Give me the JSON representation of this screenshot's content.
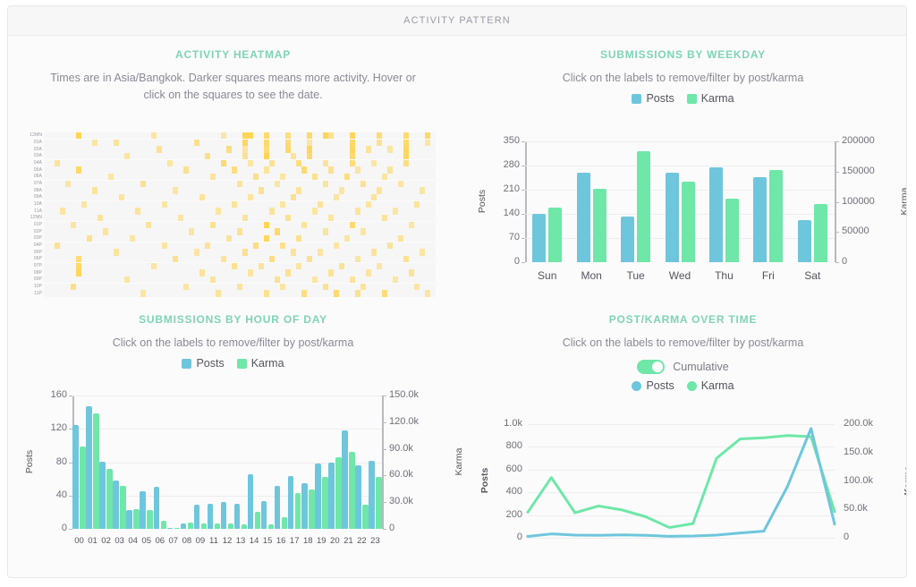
{
  "header": {
    "title": "Activity Pattern"
  },
  "colors": {
    "posts": "#6ec6dd",
    "karma": "#6ee7a8",
    "heatmap": "#ffd34e",
    "title": "#7fd4b8",
    "header_text": "#9a9aa5"
  },
  "heatmap": {
    "title": "Activity Heatmap",
    "description": "Times are in Asia/Bangkok. Darker squares means more activity. Hover or click on the squares to see the date.",
    "row_labels": [
      "12MN",
      "01A",
      "02A",
      "03A",
      "04A",
      "05A",
      "06A",
      "07A",
      "08A",
      "09A",
      "10A",
      "11A",
      "12NN",
      "01P",
      "02P",
      "03P",
      "04P",
      "05P",
      "06P",
      "07P",
      "08P",
      "09P",
      "10P",
      "11P"
    ],
    "columns": 73,
    "cells": [
      [
        0,
        6,
        0.95
      ],
      [
        0,
        20,
        0.5
      ],
      [
        0,
        33,
        0.45
      ],
      [
        0,
        37,
        0.95
      ],
      [
        0,
        38,
        0.95
      ],
      [
        0,
        41,
        0.8
      ],
      [
        0,
        45,
        0.7
      ],
      [
        0,
        49,
        0.85
      ],
      [
        0,
        52,
        0.95
      ],
      [
        0,
        53,
        0.6
      ],
      [
        0,
        57,
        0.9
      ],
      [
        0,
        62,
        0.75
      ],
      [
        0,
        67,
        0.8
      ],
      [
        0,
        71,
        0.85
      ],
      [
        1,
        9,
        0.5
      ],
      [
        1,
        13,
        0.55
      ],
      [
        1,
        28,
        0.65
      ],
      [
        1,
        37,
        0.9
      ],
      [
        1,
        41,
        0.8
      ],
      [
        1,
        45,
        0.75
      ],
      [
        1,
        49,
        0.5
      ],
      [
        1,
        57,
        0.85
      ],
      [
        1,
        62,
        0.6
      ],
      [
        1,
        67,
        0.85
      ],
      [
        1,
        71,
        0.5
      ],
      [
        2,
        21,
        0.6
      ],
      [
        2,
        34,
        0.7
      ],
      [
        2,
        37,
        0.5
      ],
      [
        2,
        41,
        0.75
      ],
      [
        2,
        45,
        0.85
      ],
      [
        2,
        49,
        0.9
      ],
      [
        2,
        57,
        0.9
      ],
      [
        2,
        60,
        0.55
      ],
      [
        2,
        64,
        0.5
      ],
      [
        2,
        67,
        0.9
      ],
      [
        3,
        15,
        0.5
      ],
      [
        3,
        30,
        0.65
      ],
      [
        3,
        37,
        0.6
      ],
      [
        3,
        41,
        0.95
      ],
      [
        3,
        46,
        0.55
      ],
      [
        3,
        49,
        0.8
      ],
      [
        3,
        57,
        0.8
      ],
      [
        3,
        67,
        0.9
      ],
      [
        4,
        2,
        0.55
      ],
      [
        4,
        23,
        0.5
      ],
      [
        4,
        33,
        0.8
      ],
      [
        4,
        38,
        0.5
      ],
      [
        4,
        42,
        0.6
      ],
      [
        4,
        47,
        0.7
      ],
      [
        4,
        52,
        0.55
      ],
      [
        4,
        57,
        0.75
      ],
      [
        4,
        61,
        0.5
      ],
      [
        4,
        67,
        0.7
      ],
      [
        5,
        6,
        0.85
      ],
      [
        5,
        26,
        0.6
      ],
      [
        5,
        35,
        0.7
      ],
      [
        5,
        41,
        0.55
      ],
      [
        5,
        48,
        0.8
      ],
      [
        5,
        53,
        0.6
      ],
      [
        5,
        58,
        0.5
      ],
      [
        5,
        64,
        0.55
      ],
      [
        6,
        12,
        0.5
      ],
      [
        6,
        31,
        0.55
      ],
      [
        6,
        39,
        0.65
      ],
      [
        6,
        44,
        0.5
      ],
      [
        6,
        50,
        0.6
      ],
      [
        6,
        56,
        0.7
      ],
      [
        6,
        63,
        0.5
      ],
      [
        7,
        4,
        0.5
      ],
      [
        7,
        18,
        0.6
      ],
      [
        7,
        36,
        0.55
      ],
      [
        7,
        43,
        0.5
      ],
      [
        7,
        52,
        0.55
      ],
      [
        7,
        59,
        0.6
      ],
      [
        7,
        66,
        0.5
      ],
      [
        8,
        9,
        0.55
      ],
      [
        8,
        24,
        0.5
      ],
      [
        8,
        40,
        0.6
      ],
      [
        8,
        47,
        0.55
      ],
      [
        8,
        55,
        0.5
      ],
      [
        8,
        62,
        0.55
      ],
      [
        8,
        70,
        0.5
      ],
      [
        9,
        14,
        0.5
      ],
      [
        9,
        29,
        0.55
      ],
      [
        9,
        38,
        0.5
      ],
      [
        9,
        46,
        0.6
      ],
      [
        9,
        54,
        0.5
      ],
      [
        9,
        61,
        0.55
      ],
      [
        10,
        7,
        0.5
      ],
      [
        10,
        22,
        0.5
      ],
      [
        10,
        35,
        0.55
      ],
      [
        10,
        44,
        0.5
      ],
      [
        10,
        51,
        0.55
      ],
      [
        10,
        60,
        0.5
      ],
      [
        10,
        69,
        0.55
      ],
      [
        11,
        3,
        0.5
      ],
      [
        11,
        17,
        0.55
      ],
      [
        11,
        32,
        0.5
      ],
      [
        11,
        42,
        0.55
      ],
      [
        11,
        50,
        0.5
      ],
      [
        11,
        58,
        0.55
      ],
      [
        11,
        65,
        0.5
      ],
      [
        12,
        10,
        0.55
      ],
      [
        12,
        25,
        0.5
      ],
      [
        12,
        37,
        0.55
      ],
      [
        12,
        45,
        0.6
      ],
      [
        12,
        53,
        0.5
      ],
      [
        12,
        63,
        0.55
      ],
      [
        13,
        5,
        0.5
      ],
      [
        13,
        19,
        0.55
      ],
      [
        13,
        31,
        0.6
      ],
      [
        13,
        41,
        0.95
      ],
      [
        13,
        48,
        0.55
      ],
      [
        13,
        57,
        0.8
      ],
      [
        13,
        68,
        0.5
      ],
      [
        14,
        11,
        0.55
      ],
      [
        14,
        27,
        0.5
      ],
      [
        14,
        36,
        0.6
      ],
      [
        14,
        43,
        0.85
      ],
      [
        14,
        52,
        0.55
      ],
      [
        14,
        59,
        0.5
      ],
      [
        15,
        8,
        0.6
      ],
      [
        15,
        16,
        0.5
      ],
      [
        15,
        34,
        0.55
      ],
      [
        15,
        41,
        0.9
      ],
      [
        15,
        47,
        0.6
      ],
      [
        15,
        56,
        0.5
      ],
      [
        15,
        66,
        0.55
      ],
      [
        16,
        2,
        0.6
      ],
      [
        16,
        22,
        0.5
      ],
      [
        16,
        30,
        0.55
      ],
      [
        16,
        39,
        0.7
      ],
      [
        16,
        44,
        0.6
      ],
      [
        16,
        54,
        0.5
      ],
      [
        16,
        64,
        0.55
      ],
      [
        17,
        13,
        0.55
      ],
      [
        17,
        28,
        0.5
      ],
      [
        17,
        37,
        0.6
      ],
      [
        17,
        46,
        0.55
      ],
      [
        17,
        51,
        0.5
      ],
      [
        17,
        61,
        0.55
      ],
      [
        17,
        70,
        0.5
      ],
      [
        18,
        6,
        0.75
      ],
      [
        18,
        24,
        0.6
      ],
      [
        18,
        33,
        0.55
      ],
      [
        18,
        42,
        0.7
      ],
      [
        18,
        49,
        0.6
      ],
      [
        18,
        58,
        0.5
      ],
      [
        18,
        67,
        0.6
      ],
      [
        19,
        6,
        0.85
      ],
      [
        19,
        20,
        0.5
      ],
      [
        19,
        35,
        0.6
      ],
      [
        19,
        40,
        0.55
      ],
      [
        19,
        47,
        0.5
      ],
      [
        19,
        55,
        0.6
      ],
      [
        19,
        62,
        0.5
      ],
      [
        20,
        6,
        0.9
      ],
      [
        20,
        29,
        0.55
      ],
      [
        20,
        38,
        0.5
      ],
      [
        20,
        45,
        0.6
      ],
      [
        20,
        53,
        0.55
      ],
      [
        20,
        60,
        0.5
      ],
      [
        20,
        68,
        0.55
      ],
      [
        21,
        15,
        0.5
      ],
      [
        21,
        31,
        0.55
      ],
      [
        21,
        43,
        0.6
      ],
      [
        21,
        50,
        0.5
      ],
      [
        21,
        57,
        0.55
      ],
      [
        21,
        65,
        0.5
      ],
      [
        22,
        5,
        0.65
      ],
      [
        22,
        26,
        0.5
      ],
      [
        22,
        36,
        0.55
      ],
      [
        22,
        44,
        0.5
      ],
      [
        22,
        52,
        0.6
      ],
      [
        22,
        59,
        0.55
      ],
      [
        22,
        69,
        0.5
      ],
      [
        23,
        18,
        0.5
      ],
      [
        23,
        32,
        0.55
      ],
      [
        23,
        41,
        0.6
      ],
      [
        23,
        48,
        0.7
      ],
      [
        23,
        54,
        0.8
      ],
      [
        23,
        58,
        0.6
      ],
      [
        23,
        63,
        0.75
      ],
      [
        23,
        71,
        0.5
      ]
    ]
  },
  "weekday": {
    "title": "Submissions by Weekday",
    "description": "Click on the labels to remove/filter by post/karma",
    "legend": [
      {
        "label": "Posts",
        "color": "#6ec6dd"
      },
      {
        "label": "Karma",
        "color": "#6ee7a8"
      }
    ]
  },
  "hourly": {
    "title": "Submissions by Hour of Day",
    "description": "Click on the labels to remove/filter by post/karma",
    "legend": [
      {
        "label": "Posts",
        "color": "#6ec6dd"
      },
      {
        "label": "Karma",
        "color": "#6ee7a8"
      }
    ]
  },
  "overtime": {
    "title": "Post/Karma Over Time",
    "description": "Click on the labels to remove/filter by post/karma",
    "toggle": {
      "label": "Cumulative",
      "on": true
    },
    "legend": [
      {
        "label": "Posts",
        "color": "#6ec6dd"
      },
      {
        "label": "Karma",
        "color": "#6ee7a8"
      }
    ]
  },
  "chart_data": [
    {
      "id": "weekday",
      "type": "bar",
      "title": "SUBMISSIONS BY WEEKDAY",
      "xlabel": "",
      "ylabel": "Posts",
      "y2label": "Karma",
      "categories": [
        "Sun",
        "Mon",
        "Tue",
        "Wed",
        "Thu",
        "Fri",
        "Sat"
      ],
      "ylim": [
        0,
        350
      ],
      "yticks": [
        0,
        70,
        140,
        210,
        280,
        350
      ],
      "y2lim": [
        0,
        200000
      ],
      "y2ticks": [
        0,
        50000,
        100000,
        150000,
        200000
      ],
      "grid": true,
      "legend_position": "top",
      "series": [
        {
          "name": "Posts",
          "axis": "left",
          "color": "#6ec6dd",
          "values": [
            139,
            258,
            133,
            258,
            276,
            246,
            121
          ]
        },
        {
          "name": "Karma",
          "axis": "right",
          "color": "#6ee7a8",
          "values": [
            91000,
            122000,
            184000,
            133000,
            105000,
            152000,
            96000
          ]
        }
      ]
    },
    {
      "id": "hourly",
      "type": "bar",
      "title": "SUBMISSIONS BY HOUR OF DAY",
      "xlabel": "",
      "ylabel": "Posts",
      "y2label": "Karma",
      "categories": [
        "00",
        "01",
        "02",
        "03",
        "04",
        "05",
        "06",
        "07",
        "08",
        "09",
        "11",
        "12",
        "13",
        "14",
        "15",
        "16",
        "17",
        "18",
        "19",
        "20",
        "21",
        "22",
        "23"
      ],
      "ylim": [
        0,
        160
      ],
      "yticks": [
        0,
        40,
        80,
        120,
        160
      ],
      "y2lim": [
        0,
        150000
      ],
      "y2ticks": [
        "0",
        "30.0k",
        "60.0k",
        "90.0k",
        "120.0k",
        "150.0k"
      ],
      "grid": true,
      "legend_position": "top",
      "series": [
        {
          "name": "Posts",
          "axis": "left",
          "color": "#6ec6dd",
          "values": [
            125,
            147,
            81,
            58,
            23,
            45,
            51,
            1,
            6,
            29,
            30,
            32,
            30,
            65,
            33,
            52,
            63,
            55,
            78,
            79,
            118,
            76,
            82
          ]
        },
        {
          "name": "Karma",
          "axis": "right",
          "color": "#6ee7a8",
          "values": [
            93000,
            130000,
            67000,
            48000,
            22000,
            21000,
            9000,
            1000,
            7000,
            6000,
            6000,
            6000,
            5000,
            19000,
            5000,
            13000,
            40000,
            44000,
            58000,
            81000,
            87000,
            27000,
            58000
          ]
        }
      ]
    },
    {
      "id": "overtime",
      "type": "line",
      "title": "POST/KARMA OVER TIME",
      "xlabel": "",
      "ylabel": "Posts",
      "y2label": "Karma",
      "ylim": [
        0,
        1000
      ],
      "yticks": [
        "0",
        "200",
        "400",
        "600",
        "800",
        "1.0k"
      ],
      "y2lim": [
        0,
        200000
      ],
      "y2ticks": [
        "0",
        "50.0k",
        "100.0k",
        "150.0k",
        "200.0k"
      ],
      "grid": true,
      "cumulative": true,
      "legend_position": "top",
      "x": [
        0,
        1,
        2,
        3,
        4,
        5,
        6,
        7,
        8,
        9,
        10,
        11,
        12,
        13
      ],
      "series": [
        {
          "name": "Posts",
          "axis": "left",
          "color": "#6ec6dd",
          "values": [
            12,
            34,
            24,
            22,
            26,
            22,
            13,
            16,
            24,
            42,
            58,
            450,
            962,
            120
          ]
        },
        {
          "name": "Karma",
          "axis": "right",
          "color": "#6ee7a8",
          "values": [
            45000,
            106000,
            44000,
            56000,
            49000,
            37000,
            18000,
            25000,
            140000,
            174000,
            176000,
            180000,
            178000,
            46000
          ]
        }
      ]
    }
  ]
}
